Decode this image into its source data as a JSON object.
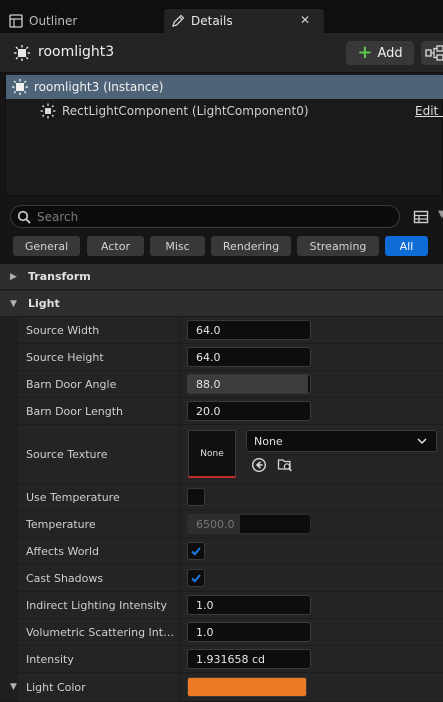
{
  "tabs": [
    {
      "label": "Outliner"
    },
    {
      "label": "Details"
    }
  ],
  "header": {
    "actor_name": "roomlight3",
    "add_label": "Add"
  },
  "tree": {
    "instance_label": "roomlight3 (Instance)",
    "component_label": "RectLightComponent (LightComponent0)",
    "edit_label": "Edit in"
  },
  "search": {
    "placeholder": "Search"
  },
  "filters": [
    {
      "label": "General",
      "active": false
    },
    {
      "label": "Actor",
      "active": false
    },
    {
      "label": "Misc",
      "active": false
    },
    {
      "label": "Rendering",
      "active": false
    },
    {
      "label": "Streaming",
      "active": false
    },
    {
      "label": "All",
      "active": true
    }
  ],
  "sections": {
    "transform": "Transform",
    "light": "Light"
  },
  "properties": {
    "source_width": {
      "label": "Source Width",
      "value": "64.0"
    },
    "source_height": {
      "label": "Source Height",
      "value": "64.0"
    },
    "barn_door_angle": {
      "label": "Barn Door Angle",
      "value": "88.0",
      "slider_fraction": 0.98
    },
    "barn_door_length": {
      "label": "Barn Door Length",
      "value": "20.0"
    },
    "source_texture": {
      "label": "Source Texture",
      "thumb_label": "None",
      "value": "None"
    },
    "use_temperature": {
      "label": "Use Temperature",
      "checked": false
    },
    "temperature": {
      "label": "Temperature",
      "value": "6500.0",
      "slider_fraction": 0.43
    },
    "affects_world": {
      "label": "Affects World",
      "checked": true
    },
    "cast_shadows": {
      "label": "Cast Shadows",
      "checked": true
    },
    "indirect_lighting_intensity": {
      "label": "Indirect Lighting Intensity",
      "value": "1.0"
    },
    "volumetric_scattering_intensity": {
      "label": "Volumetric Scattering Intensity",
      "value": "1.0"
    },
    "intensity": {
      "label": "Intensity",
      "value": "1.931658 cd"
    },
    "light_color": {
      "label": "Light Color",
      "color": "#ef7a25"
    }
  },
  "colors": {
    "accent": "#0f6bd6",
    "selection": "#4f6378",
    "add_plus": "#5ec44a",
    "check": "#1f7be8"
  }
}
